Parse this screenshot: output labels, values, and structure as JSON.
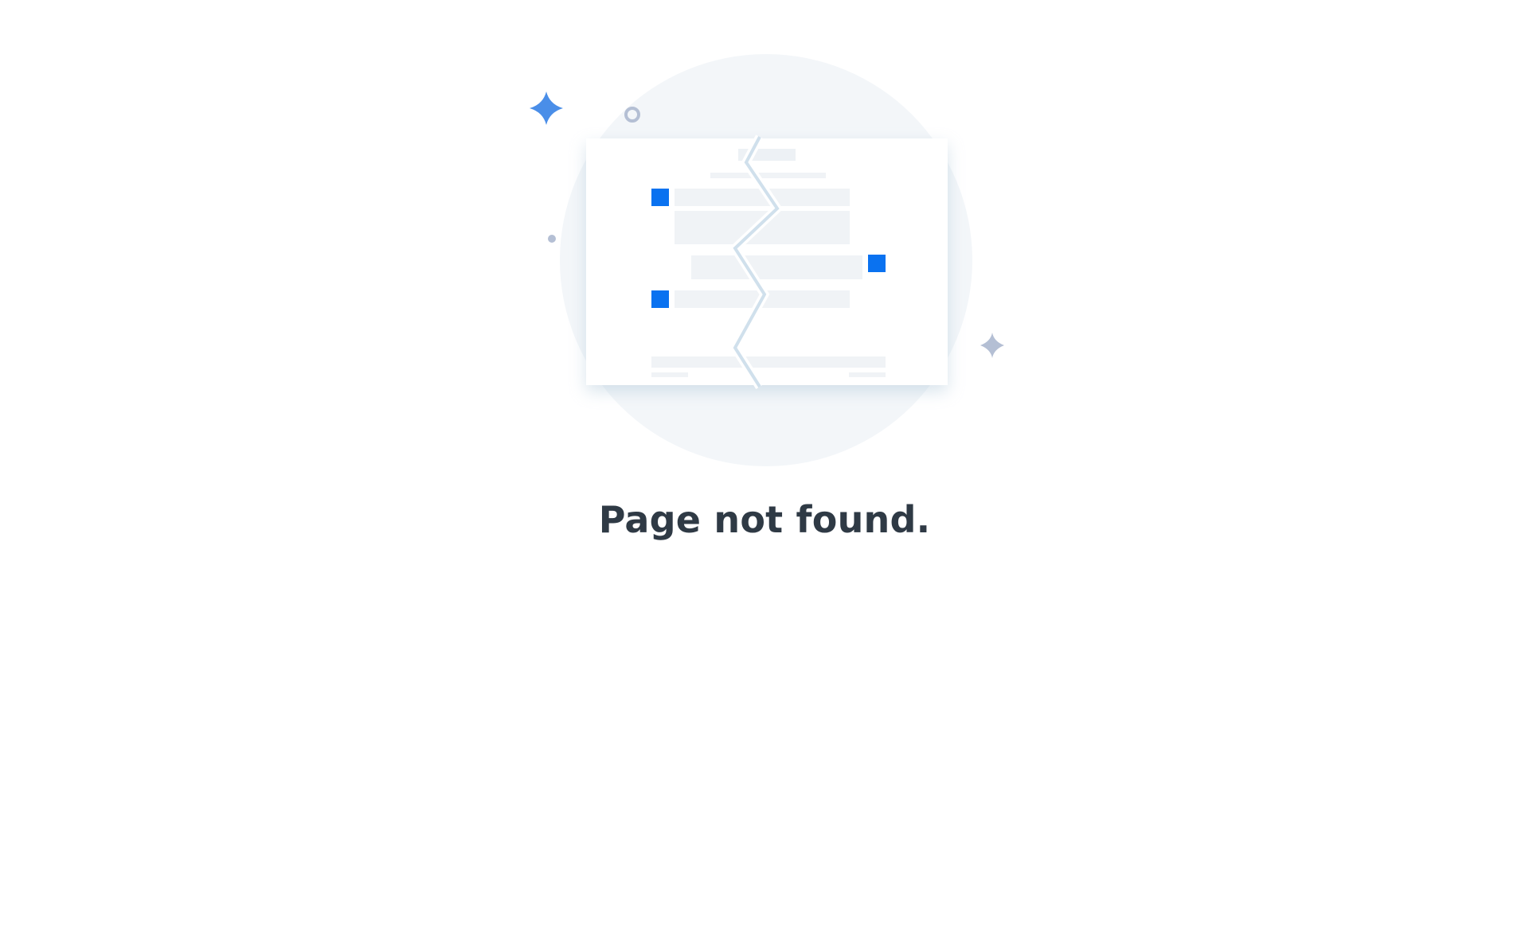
{
  "page": {
    "message": "Page not found."
  },
  "illustration": {
    "icons": [
      "sparkle-icon",
      "ring-icon",
      "dot-icon",
      "small-sparkle-icon",
      "broken-page-icon"
    ],
    "colors": {
      "accent": "#0a72f0",
      "sparkle": "#4a8ee8",
      "muted_sparkle": "#b4bfd4",
      "backdrop": "#f3f6f9",
      "crack": "#d0e0ec",
      "placeholder": "#f0f3f6",
      "text": "#2f3a45"
    }
  }
}
